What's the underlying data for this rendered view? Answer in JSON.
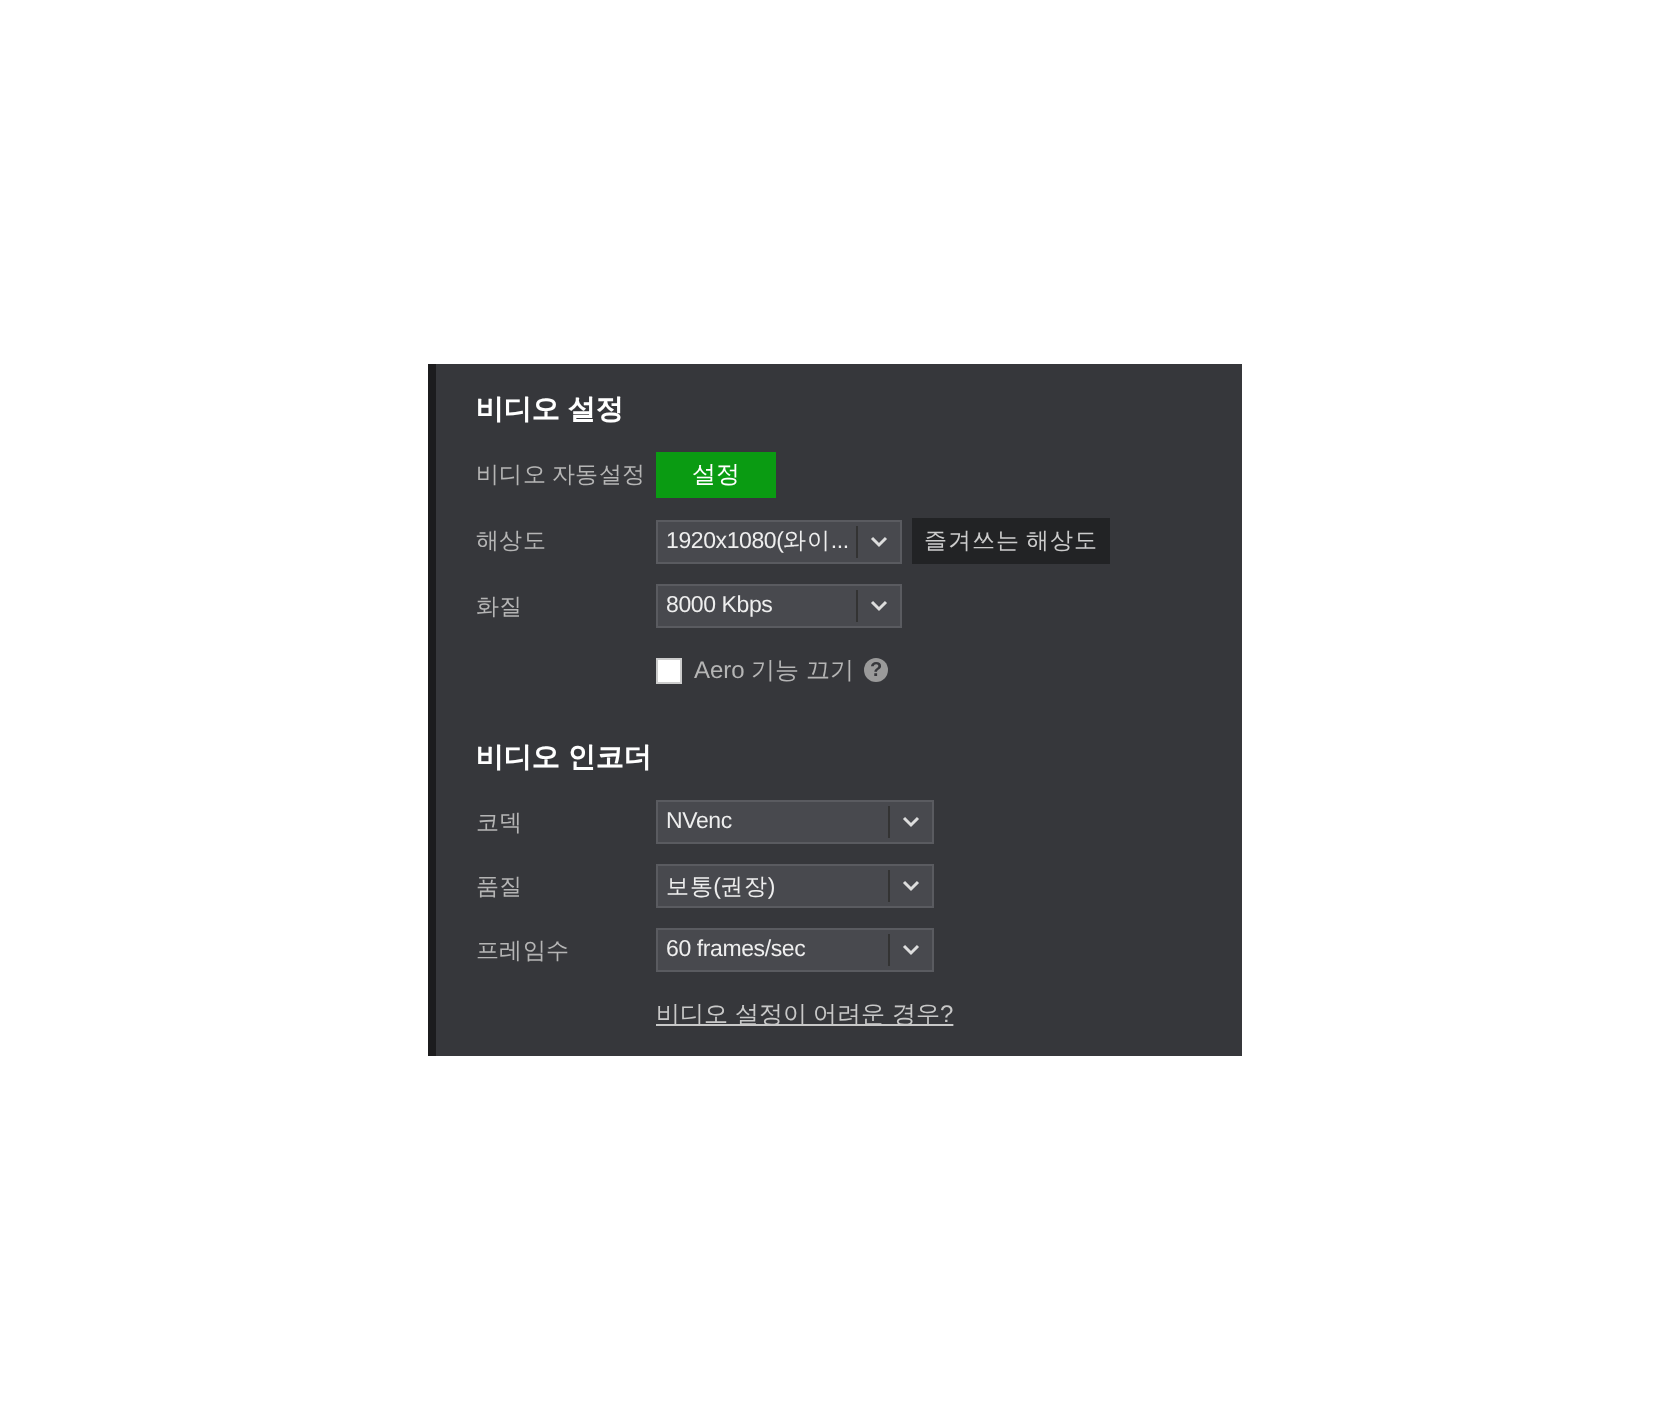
{
  "sections": [
    {
      "title": "비디오 설정",
      "rows": [
        {
          "kind": "button",
          "label": "비디오 자동설정",
          "button": "설정"
        },
        {
          "kind": "select",
          "label": "해상도",
          "value": "1920x1080(와이...",
          "extra_button": "즐겨쓰는 해상도"
        },
        {
          "kind": "select",
          "label": "화질",
          "value": "8000 Kbps"
        },
        {
          "kind": "checkbox",
          "label": "Aero 기능 끄기",
          "checked": false,
          "help": "?"
        }
      ]
    },
    {
      "title": "비디오 인코더",
      "rows": [
        {
          "kind": "wide-select",
          "label": "코덱",
          "value": "NVenc"
        },
        {
          "kind": "wide-select",
          "label": "품질",
          "value": "보통(권장)"
        },
        {
          "kind": "wide-select",
          "label": "프레임수",
          "value": "60 frames/sec"
        },
        {
          "kind": "link",
          "text": "비디오 설정이 어려운 경우?"
        }
      ]
    }
  ]
}
